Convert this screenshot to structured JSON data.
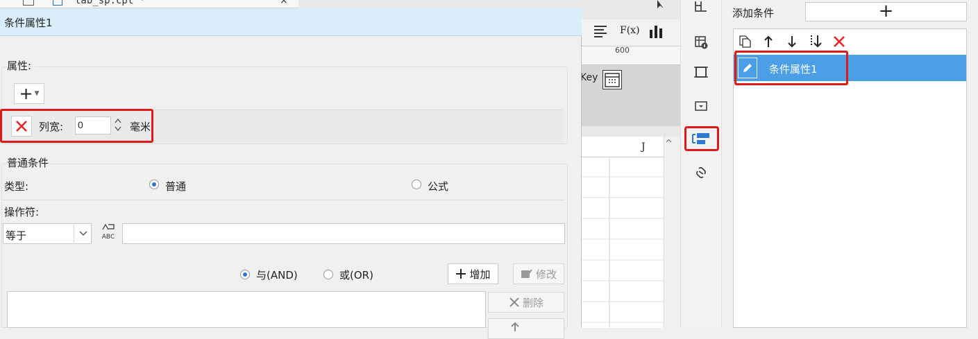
{
  "background": {
    "tab_text": "tab_sp.cpt *",
    "tab_close": "×",
    "ruler_num": "600",
    "key_text": "Key",
    "column_label": "J",
    "toolbar_icons": [
      "align-icon",
      "formula-icon",
      "chart-icon"
    ],
    "toolbar_fx": "F(x)"
  },
  "dialog": {
    "title": "条件属性1",
    "attr_group_label": "属性:",
    "attr_add_symbol": "+",
    "attr_row": {
      "label": "列宽:",
      "value": "0",
      "unit": "毫米"
    },
    "normal_group_label": "普通条件",
    "type_label": "类型:",
    "type_options": [
      "普通",
      "公式"
    ],
    "type_selected": "普通",
    "operator_label": "操作符:",
    "operator_value": "等于",
    "operator_value_placeholder": "",
    "logic_options": [
      "与(AND)",
      "或(OR)"
    ],
    "logic_selected": "与(AND)",
    "add_button": "增加",
    "modify_button": "修改",
    "delete_button": "删除",
    "abc_icon_text": "ABC"
  },
  "right_panel": {
    "add_condition_label": "添加条件",
    "add_condition_symbol": "+",
    "conditions": [
      {
        "label": "条件属性1",
        "selected": true
      }
    ]
  },
  "colors": {
    "dialog_title_bg": "#d9eefa",
    "selected_row_bg": "#4a9fe8",
    "highlight_red": "#e01818",
    "delete_red": "#e22222"
  }
}
